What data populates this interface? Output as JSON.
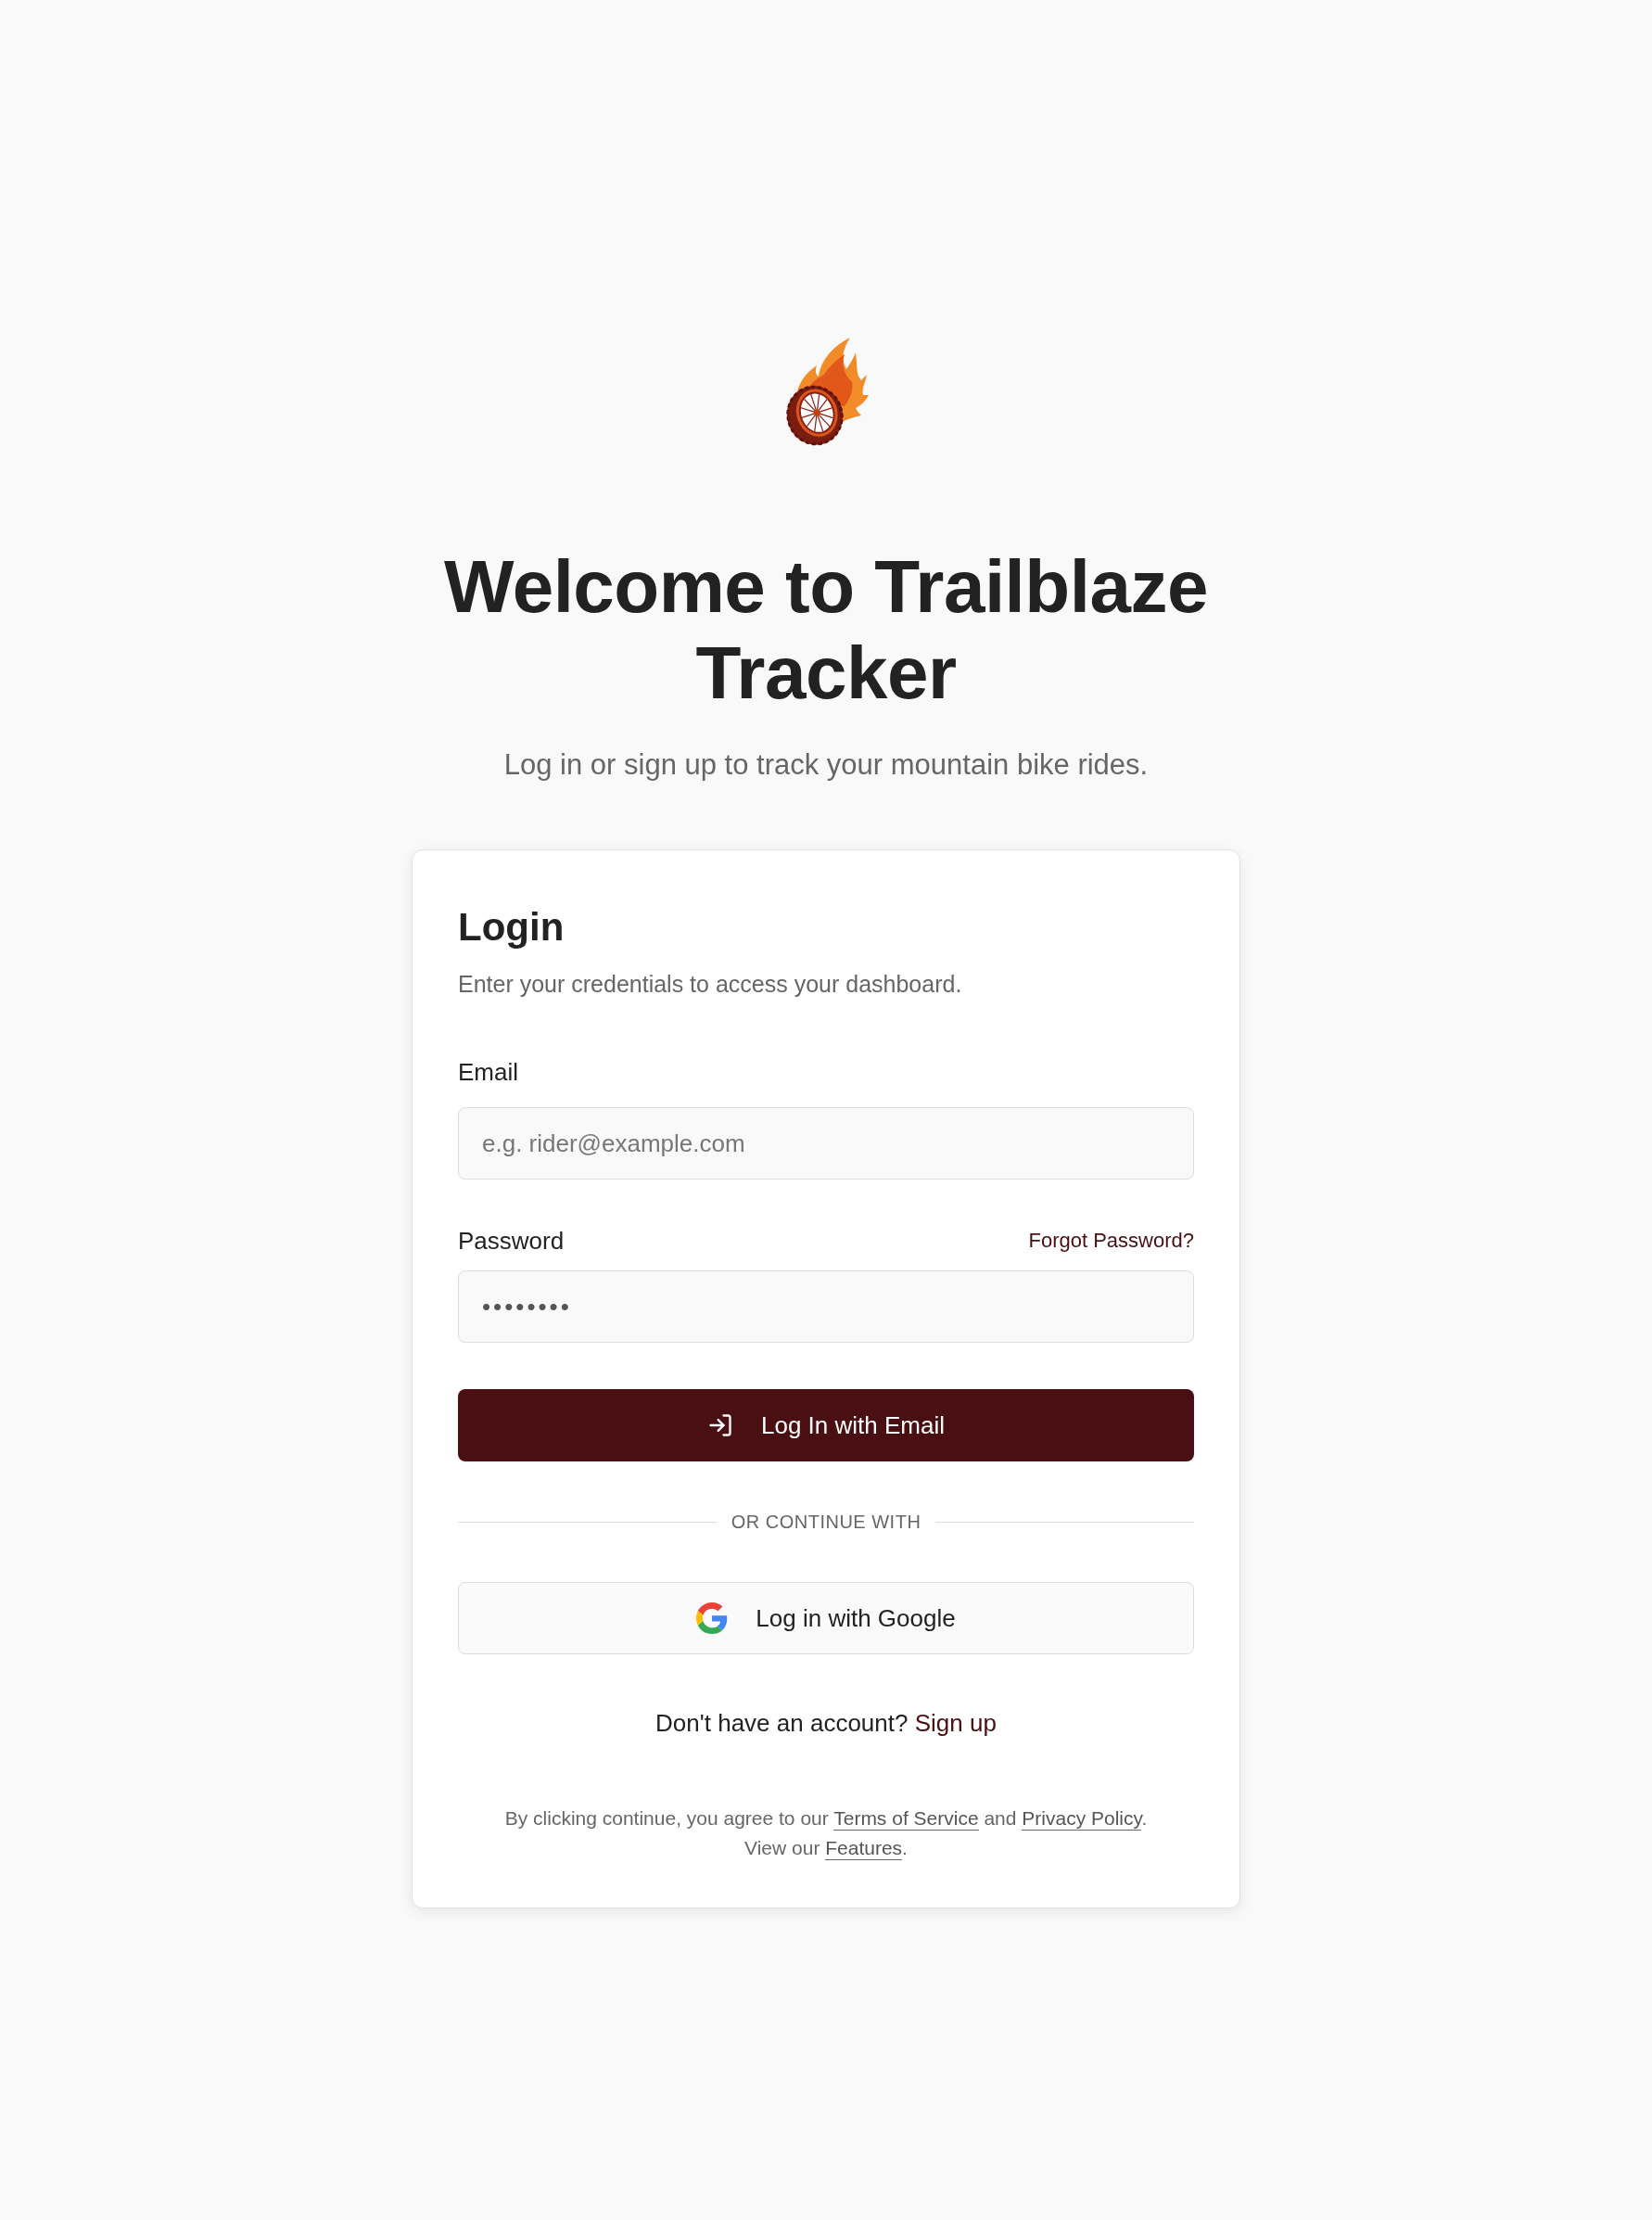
{
  "header": {
    "title": "Welcome to Trailblaze Tracker",
    "subtitle": "Log in or sign up to track your mountain bike rides."
  },
  "login_card": {
    "title": "Login",
    "description": "Enter your credentials to access your dashboard.",
    "fields": [
      {
        "kind": "email",
        "label": "Email",
        "placeholder": "e.g. rider@example.com"
      },
      {
        "kind": "password",
        "label": "Password",
        "link": "Forgot Password?",
        "value": "••••••••"
      }
    ],
    "submit_button": {
      "label": "Log In with Email"
    },
    "divider": "OR CONTINUE WITH",
    "google_button": {
      "label": "Log in with Google"
    },
    "signup": {
      "prompt": "Don't have an account?",
      "link": "Sign up"
    },
    "legal": [
      [
        {
          "kind": "text",
          "text": "By clicking continue, you agree to our "
        },
        {
          "kind": "link",
          "text": "Terms of Service"
        },
        {
          "kind": "text",
          "text": " and "
        },
        {
          "kind": "link",
          "text": "Privacy Policy"
        },
        {
          "kind": "text",
          "text": "."
        }
      ],
      [
        {
          "kind": "text",
          "text": "View our "
        },
        {
          "kind": "link",
          "text": "Features"
        },
        {
          "kind": "text",
          "text": "."
        }
      ]
    ]
  }
}
